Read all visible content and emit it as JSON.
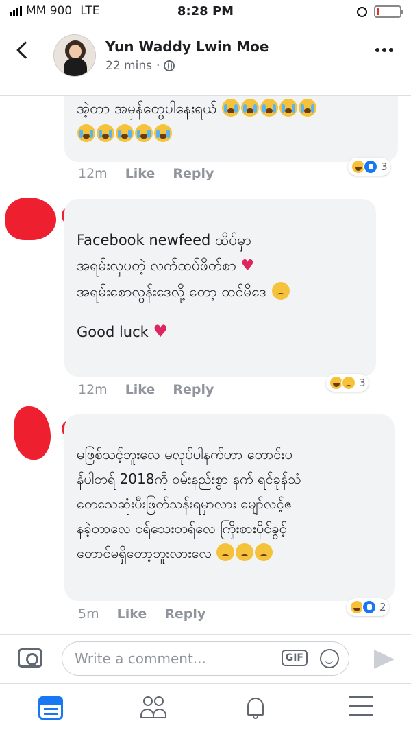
{
  "status_bar": {
    "carrier": "MM 900",
    "network": "LTE",
    "time": "8:28 PM"
  },
  "header": {
    "author_name": "Yun Waddy Lwin Moe",
    "time_ago": "22 mins",
    "separator": "·"
  },
  "comments": [
    {
      "lines": [
        "အဲ့တာ အမှန်တွေပါနေးရယ်"
      ],
      "time": "12m",
      "like_label": "Like",
      "reply_label": "Reply",
      "reaction_count": "3"
    },
    {
      "lines": [
        "Facebook newfeed ထိပ်မှာ",
        "အရမ်းလှပတဲ့ လက်ထပ်ဖိတ်စာ",
        "အရမ်းစောလွန်းဒေလို့ တော့ ထင်မိဒေ",
        "",
        "Good luck"
      ],
      "time": "12m",
      "like_label": "Like",
      "reply_label": "Reply",
      "reaction_count": "3"
    },
    {
      "lines": [
        "မဖြစ်သင့်ဘူးလေ မလုပ်ပါနက်ဟာ တောင်းပ",
        "န်ပါတရ် 2018ကို ဝမ်းနည်းစွာ နက် ရင်ခုန်သံ",
        "တေသေဆုံးပီးဖြတ်သန်းရမှာလား မျော်လင့်ဇ",
        "နခဲ့တာလေ ငရ်သေးတရ်လေ ကြိုးစားပိုင်ခွင့်",
        "တောင်မရှိတော့ဘူးလားလေ"
      ],
      "time": "5m",
      "like_label": "Like",
      "reply_label": "Reply",
      "reaction_count": "2"
    }
  ],
  "composer": {
    "placeholder": "Write a comment...",
    "gif_label": "GIF"
  },
  "colors": {
    "accent": "#1877f2",
    "bubble": "#f2f3f5",
    "muted": "#90949c",
    "redact": "#ee1f2e"
  },
  "icons": [
    "back-icon",
    "globe-icon",
    "more-icon",
    "camera-icon",
    "gif-icon",
    "emoji-icon",
    "send-icon",
    "news-feed-icon",
    "friends-icon",
    "notifications-icon",
    "menu-icon"
  ]
}
